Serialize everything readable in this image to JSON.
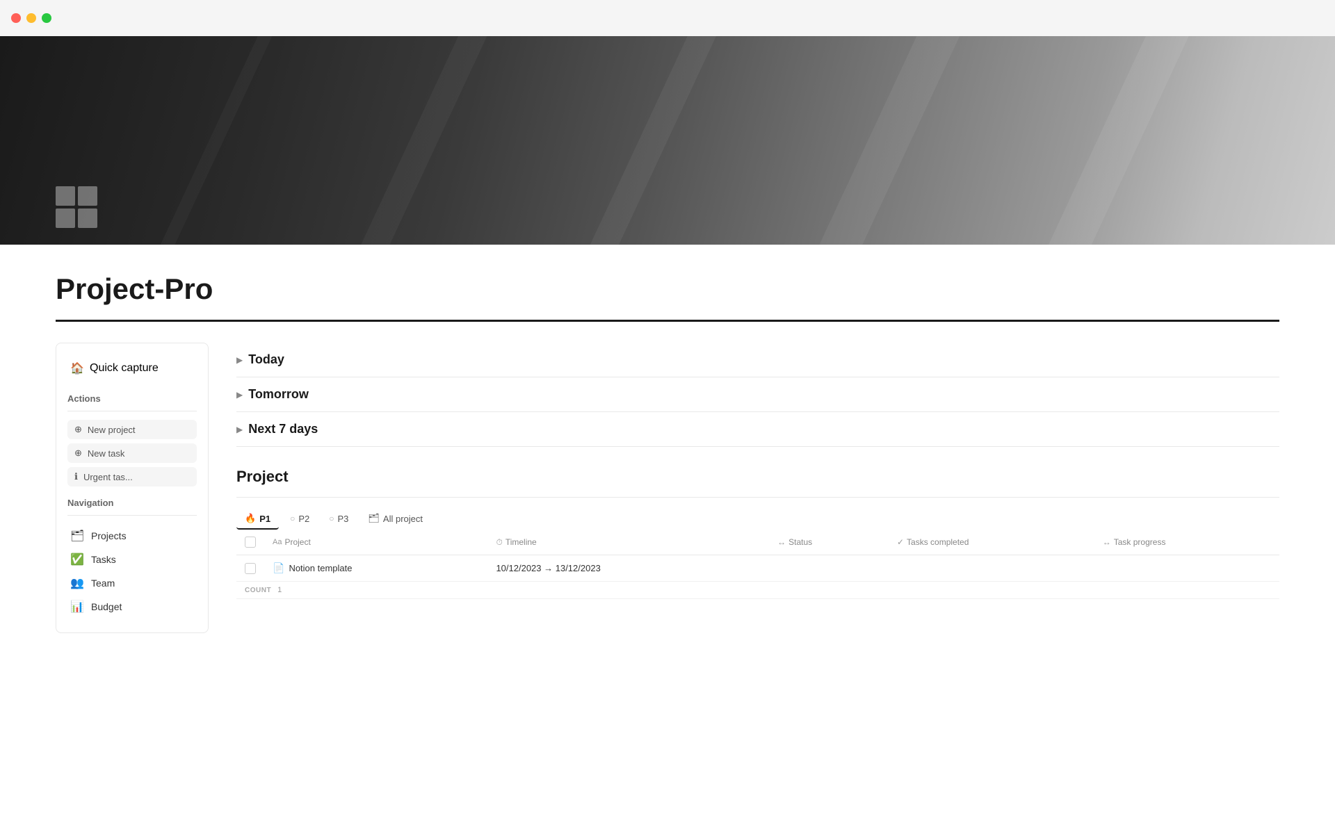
{
  "window": {
    "title": "Project-Pro"
  },
  "sidebar": {
    "quick_capture_label": "Quick capture",
    "actions_label": "Actions",
    "nav_label": "Navigation",
    "action_buttons": [
      {
        "id": "new-project",
        "label": "New project",
        "icon": "⊕"
      },
      {
        "id": "new-task",
        "label": "New task",
        "icon": "⊕"
      },
      {
        "id": "urgent-tasks",
        "label": "Urgent tas...",
        "icon": "ℹ"
      }
    ],
    "nav_items": [
      {
        "id": "projects",
        "label": "Projects",
        "icon": "🗂"
      },
      {
        "id": "tasks",
        "label": "Tasks",
        "icon": "✅"
      },
      {
        "id": "team",
        "label": "Team",
        "icon": "👥"
      },
      {
        "id": "budget",
        "label": "Budget",
        "icon": "📊"
      }
    ]
  },
  "main": {
    "page_title": "Project-Pro",
    "sections": [
      {
        "id": "today",
        "label": "Today"
      },
      {
        "id": "tomorrow",
        "label": "Tomorrow"
      },
      {
        "id": "next7days",
        "label": "Next 7 days"
      }
    ],
    "project_section": {
      "heading": "Project",
      "tabs": [
        {
          "id": "p1",
          "label": "P1",
          "icon": "🔥",
          "active": true
        },
        {
          "id": "p2",
          "label": "P2",
          "icon": "○",
          "active": false
        },
        {
          "id": "p3",
          "label": "P3",
          "icon": "○",
          "active": false
        },
        {
          "id": "all",
          "label": "All project",
          "icon": "🗂",
          "active": false
        }
      ],
      "table": {
        "columns": [
          {
            "id": "checkbox",
            "label": ""
          },
          {
            "id": "project",
            "label": "Project"
          },
          {
            "id": "timeline",
            "label": "Timeline"
          },
          {
            "id": "status",
            "label": "Status"
          },
          {
            "id": "tasks_completed",
            "label": "Tasks completed"
          },
          {
            "id": "task_progress",
            "label": "Task progress"
          }
        ],
        "rows": [
          {
            "id": "row1",
            "project": "Notion template",
            "project_icon": "📄",
            "timeline": "10/12/2023 → 13/12/2023",
            "status": "",
            "tasks_completed": "",
            "task_progress": ""
          }
        ],
        "count_label": "COUNT",
        "count_value": "1"
      }
    }
  }
}
